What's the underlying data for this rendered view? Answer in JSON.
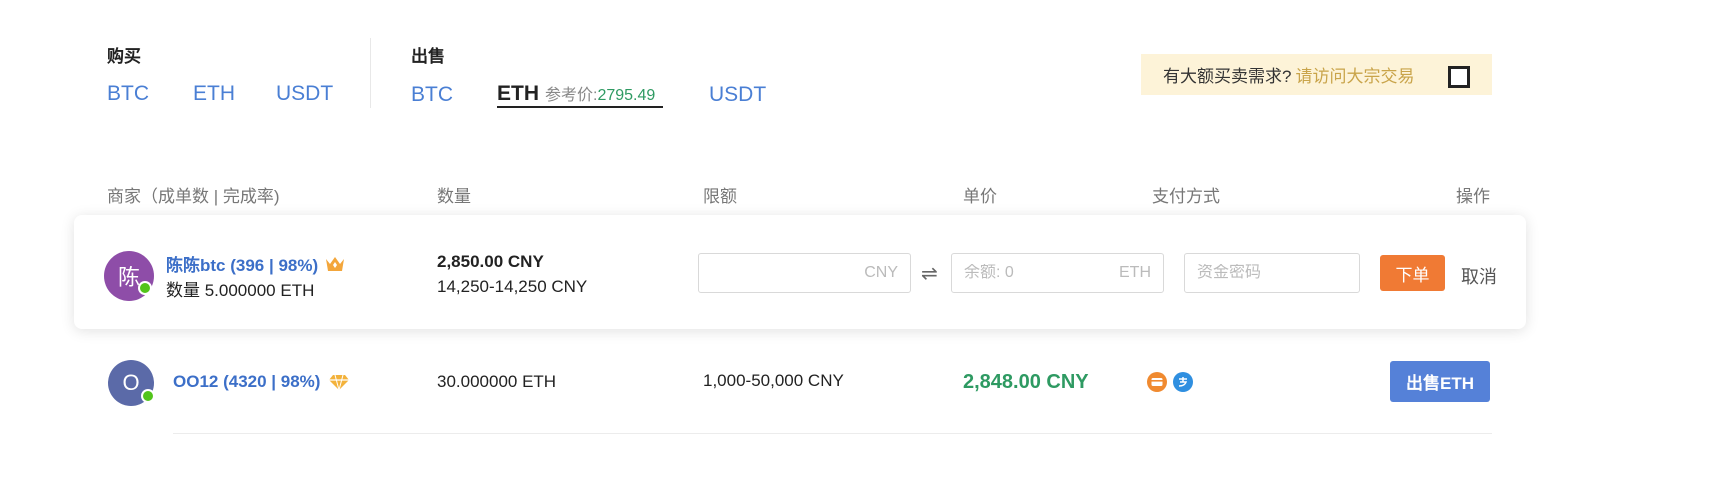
{
  "buy": {
    "title": "购买",
    "coins": [
      "BTC",
      "ETH",
      "USDT"
    ]
  },
  "sell": {
    "title": "出售",
    "coins": [
      "BTC",
      "ETH",
      "USDT"
    ],
    "active_coin": "ETH",
    "ref_price_label": "参考价:",
    "ref_price_value": "2795.49"
  },
  "notice": {
    "text": "有大额买卖需求?",
    "link": "请访问大宗交易"
  },
  "table": {
    "headers": [
      "商家（成单数 | 完成率)",
      "数量",
      "限额",
      "单价",
      "支付方式",
      "操作"
    ]
  },
  "orders": [
    {
      "avatar_text": "陈",
      "avatar_color": "#8e4da8",
      "name": "陈陈btc (396 | 98%)",
      "badge": "crown-icon",
      "sub": "数量 5.000000 ETH",
      "price": "2,850.00 CNY",
      "limit": "14,250-14,250 CNY",
      "cny_unit": "CNY",
      "swap_icon": "⇌",
      "eth_placeholder": "余额: 0",
      "eth_unit": "ETH",
      "password_placeholder": "资金密码",
      "submit_label": "下单",
      "cancel_label": "取消"
    },
    {
      "avatar_text": "O",
      "avatar_color": "#5b6aa8",
      "name": "OO12 (4320 | 98%)",
      "badge": "diamond-icon",
      "quantity": "30.000000 ETH",
      "limit": "1,000-50,000 CNY",
      "price": "2,848.00 CNY",
      "payments": [
        "bank-card-icon",
        "alipay-icon"
      ],
      "action_label": "出售ETH"
    }
  ],
  "colors": {
    "link_blue": "#4a7fd4",
    "price_green": "#2e9a62",
    "orange_button": "#f07a34",
    "blue_button": "#5581d8",
    "notice_bg": "#fdf3d8"
  }
}
